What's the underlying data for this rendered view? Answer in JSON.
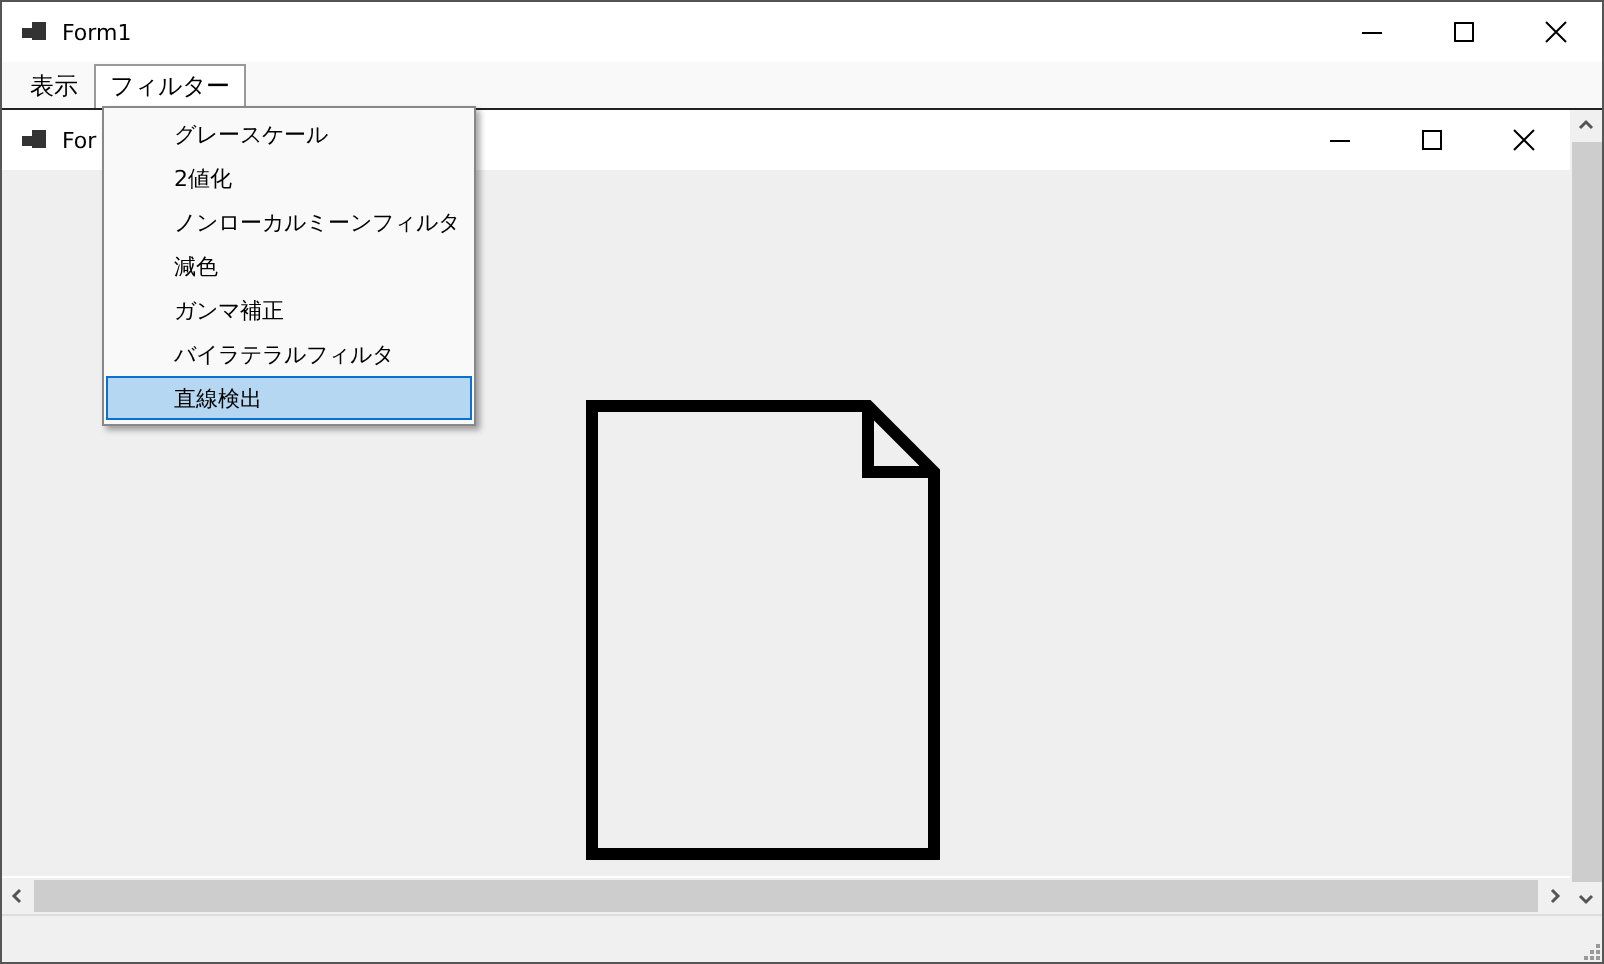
{
  "window": {
    "title": "Form1"
  },
  "menu": [
    {
      "label": "表示",
      "selected": false
    },
    {
      "label": "フィルター",
      "selected": true
    }
  ],
  "dropdown": [
    {
      "label": "グレースケール",
      "selected": false
    },
    {
      "label": "2値化",
      "selected": false
    },
    {
      "label": "ノンローカルミーンフィルタ",
      "selected": false
    },
    {
      "label": "減色",
      "selected": false
    },
    {
      "label": "ガンマ補正",
      "selected": false
    },
    {
      "label": "バイラテラルフィルタ",
      "selected": false
    },
    {
      "label": "直線検出",
      "selected": true
    }
  ],
  "child_window": {
    "title": "For"
  }
}
